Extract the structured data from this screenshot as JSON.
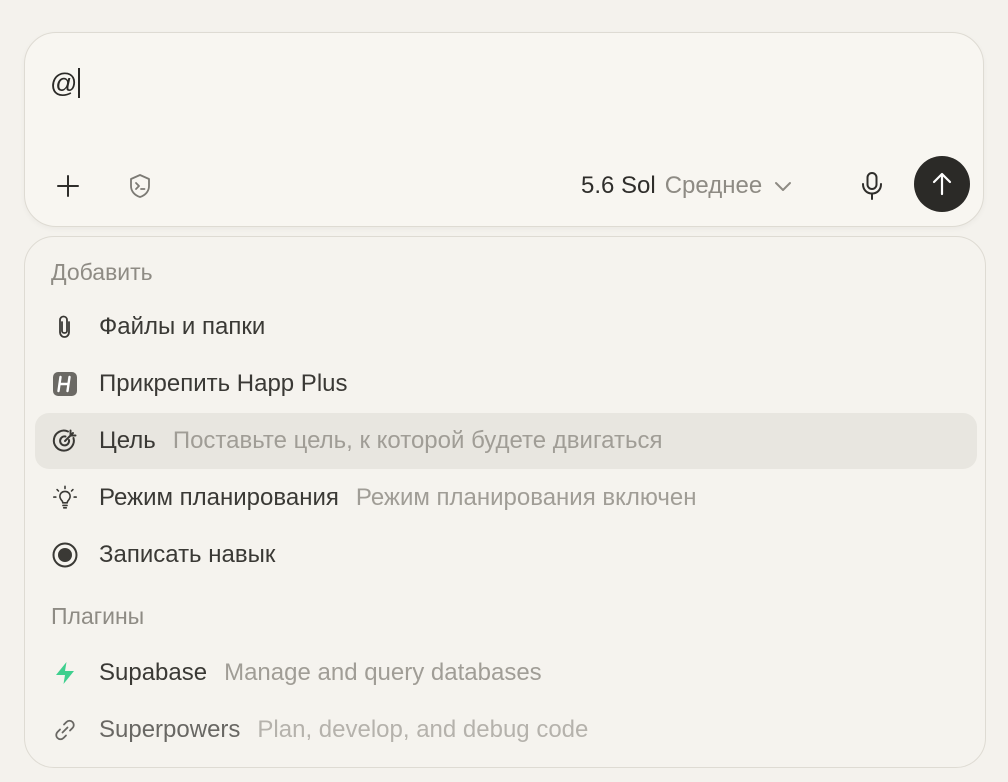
{
  "composer": {
    "input_value": "@",
    "model_name": "5.6 Sol",
    "model_level": "Среднее"
  },
  "menu": {
    "sections": {
      "add_title": "Добавить",
      "plugins_title": "Плагины"
    },
    "add_items": [
      {
        "label": "Файлы и папки",
        "icon": "paperclip-icon"
      },
      {
        "label": "Прикрепить Happ Plus",
        "icon": "happ-plus-icon"
      },
      {
        "label": "Цель",
        "description": "Поставьте цель, к которой будете двигаться",
        "icon": "target-icon",
        "highlighted": true
      },
      {
        "label": "Режим планирования",
        "description": "Режим планирования включен",
        "icon": "lightbulb-icon"
      },
      {
        "label": "Записать навык",
        "icon": "record-icon"
      }
    ],
    "plugin_items": [
      {
        "label": "Supabase",
        "description": "Manage and query databases",
        "icon": "supabase-icon"
      },
      {
        "label": "Superpowers",
        "description": "Plan, develop, and debug code",
        "icon": "link-icon"
      }
    ]
  },
  "colors": {
    "background": "#f4f2ed",
    "send_button": "#2b2a27",
    "highlight": "#e8e6e0",
    "supabase_green": "#3ecf8e"
  }
}
